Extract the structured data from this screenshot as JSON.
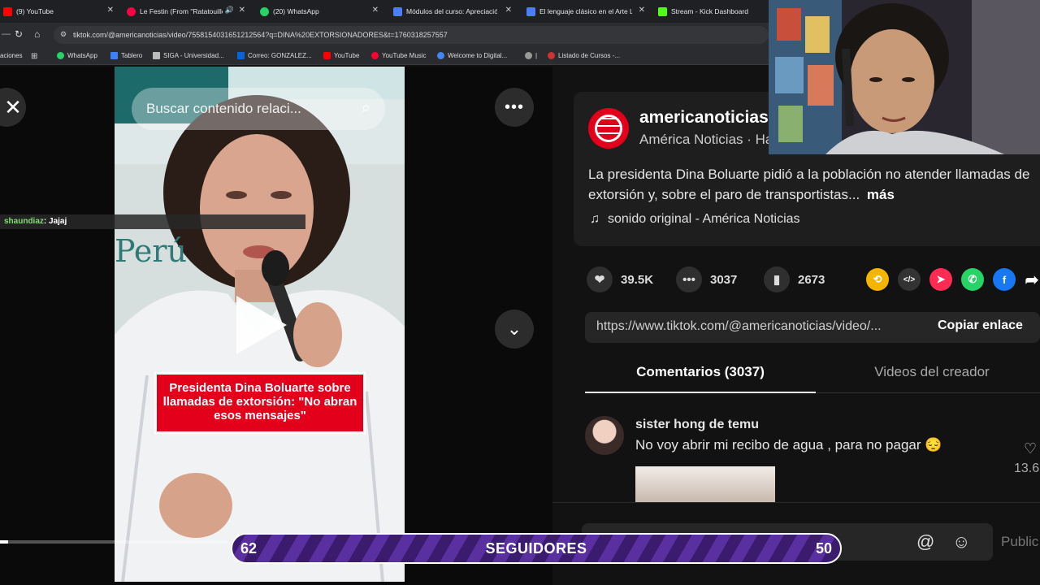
{
  "browser": {
    "tabs": [
      {
        "title": "(9) YouTube",
        "color": "#ff0000"
      },
      {
        "title": "Le Festin (From \"Ratatouille\")",
        "color": "#ff0044"
      },
      {
        "title": "(20) WhatsApp",
        "color": "#25d366"
      },
      {
        "title": "Módulos del curso: Apreciación",
        "color": "#4a7dff"
      },
      {
        "title": "El lenguaje clásico en el Arte Lp",
        "color": "#4a7dff"
      },
      {
        "title": "Stream - Kick Dashboard",
        "color": "#53fc18"
      }
    ],
    "url": "tiktok.com/@americanoticias/video/7558154031651212564?q=DINA%20EXTORSIONADORES&t=1760318257557",
    "bookmarks": [
      {
        "label": "aciones",
        "color": "#888"
      },
      {
        "label": "WhatsApp",
        "color": "#25d366"
      },
      {
        "label": "Tablero",
        "color": "#3b82f6"
      },
      {
        "label": "SIGA - Universidad...",
        "color": "#bbbbbb"
      },
      {
        "label": "Correo: GONZALEZ...",
        "color": "#0a64d8"
      },
      {
        "label": "YouTube",
        "color": "#ff0000"
      },
      {
        "label": "YouTube Music",
        "color": "#ff0033"
      },
      {
        "label": "Welcome to Digital...",
        "color": "#4285f4"
      },
      {
        "label": "|",
        "color": "#888"
      },
      {
        "label": "Listado de Cursos -...",
        "color": "#cc3333"
      }
    ]
  },
  "video": {
    "search_placeholder": "Buscar contenido relaci...",
    "caption": "Presidenta Dina Boluarte sobre llamadas de extorsión: \"No abran esos mensajes\"",
    "background_word": "Perú"
  },
  "chat": {
    "user": "shaundiaz",
    "message": ": Jajaj"
  },
  "post": {
    "username": "americanoticias",
    "display": "América Noticias · Ha",
    "description": "La presidenta Dina Boluarte pidió a la población no atender llamadas de extorsión y, sobre el paro de transportistas...",
    "more": "más",
    "sound": "sonido original - América Noticias",
    "likes": "39.5K",
    "comments": "3037",
    "saves": "2673",
    "link": "https://www.tiktok.com/@americanoticias/video/...",
    "copy_label": "Copiar enlace",
    "tab_comments": "Comentarios (3037)",
    "tab_videos": "Videos del creador"
  },
  "comment": {
    "author": "sister hong de temu",
    "text": "No voy abrir mi recibo de agua , para no pagar 😔",
    "likes": "13.6"
  },
  "input": {
    "post_label": "Public"
  },
  "followers": {
    "left": "62",
    "label": "SEGUIDORES",
    "right": "50",
    "accent": "#5a2fa0"
  }
}
